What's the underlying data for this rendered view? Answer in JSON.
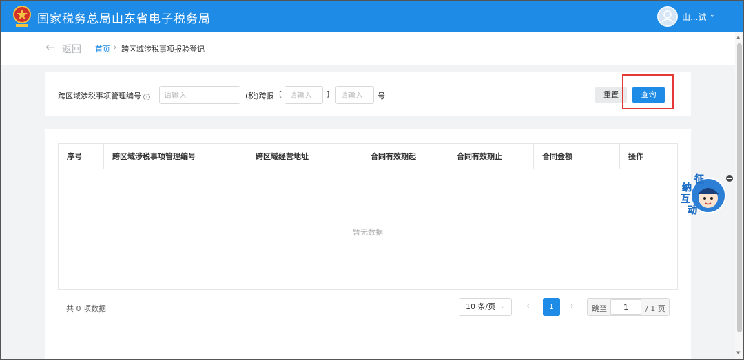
{
  "header": {
    "title": "国家税务总局山东省电子税务局",
    "user_name": "山...试"
  },
  "breadcrumb": {
    "back_label": "返回",
    "home": "首页",
    "separator": "›",
    "current": "跨区域涉税事项报验登记"
  },
  "search": {
    "mgmt_no_label": "跨区域涉税事项管理编号",
    "mgmt_no_placeholder": "请输入",
    "tax_label": "(税)跨报",
    "bracket_open": "[",
    "bracket_close": "]",
    "tax_year_placeholder": "请输入",
    "tax_no_placeholder": "请输入",
    "hao_label": "号",
    "reset_label": "重置",
    "query_label": "查询"
  },
  "table": {
    "columns": [
      "序号",
      "跨区域涉税事项管理编号",
      "跨区域经营地址",
      "合同有效期起",
      "合同有效期止",
      "合同金额",
      "操作"
    ],
    "rows": [],
    "empty_text": "暂无数据"
  },
  "pagination": {
    "total_text": "共 0 项数据",
    "page_size": "10 条/页",
    "current_page": "1",
    "jump_label": "跳至",
    "jump_value": "1",
    "total_pages_text": "/ 1 页"
  },
  "widget": {
    "chars": [
      "征",
      "纳",
      "互",
      "动"
    ]
  },
  "colors": {
    "brand_blue": "#1e8be6",
    "highlight_red": "#e53935"
  }
}
